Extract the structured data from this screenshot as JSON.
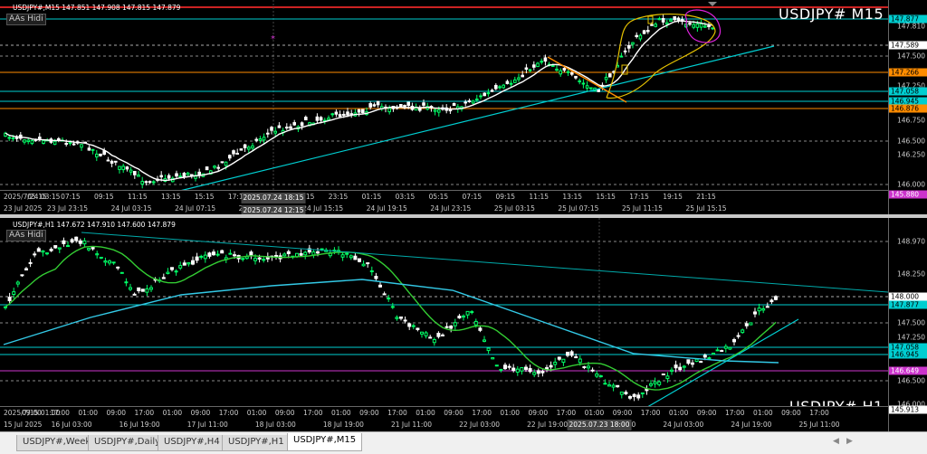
{
  "charts": [
    {
      "title": "USDJPY#,M15  147.851 147.908 147.815 147.879",
      "big_label": "USDJPY#  M15",
      "as_hidi": "AAs Hidi",
      "prices": [
        "147.810",
        "147.500",
        "147.250",
        "146.750",
        "146.500",
        "146.250",
        "146.000"
      ],
      "tags": [
        {
          "label": "147.877",
          "color": "#00ced1"
        },
        {
          "label": "147.589",
          "color": "#ffffff"
        },
        {
          "label": "147.266",
          "color": "#ff8c00"
        },
        {
          "label": "147.058",
          "color": "#00ced1"
        },
        {
          "label": "146.945",
          "color": "#00ced1"
        },
        {
          "label": "146.876",
          "color": "#ff8c00"
        },
        {
          "label": "145.880",
          "color": "#cc33cc"
        }
      ],
      "time_labels": [
        "2025/7/24 03:15",
        "05:15",
        "07:15",
        "09:15",
        "11:15",
        "13:15",
        "15:15",
        "17:15",
        "19:15",
        "21:15",
        "23:15",
        "01:15",
        "03:15",
        "05:15",
        "07:15",
        "09:15",
        "11:15",
        "13:15",
        "15:15",
        "17:15",
        "19:15",
        "21:15"
      ],
      "date_labels": [
        "23 Jul 2025",
        "23 Jul 23:15",
        "24 Jul 03:15",
        "24 Jul 07:15",
        "24 Jul 11:15",
        "24 Jul 15:15",
        "24 Jul 19:15",
        "24 Jul 23:15",
        "25 Jul 03:15",
        "25 Jul 07:15",
        "25 Jul 11:15",
        "25 Jul 15:15"
      ],
      "highlights": [
        "2025.07.24 18:15",
        "2025.07.24 12:15"
      ]
    },
    {
      "title": "USDJPY#,H1  147.672 147.910 147.600 147.879",
      "big_label": "USDJPY#  H1",
      "as_hidi": "AAs Hidi",
      "prices": [
        "148.970",
        "148.250",
        "147.500",
        "147.250",
        "146.500",
        "146.000"
      ],
      "tags": [
        {
          "label": "148.000",
          "color": "#ffffff"
        },
        {
          "label": "147.877",
          "color": "#00ced1"
        },
        {
          "label": "147.058",
          "color": "#00ced1"
        },
        {
          "label": "146.945",
          "color": "#00ced1"
        },
        {
          "label": "146.649",
          "color": "#cc33cc"
        },
        {
          "label": "145.913",
          "color": "#ffffff"
        }
      ],
      "time_labels": [
        "2025/7/15 01:00",
        "09:00",
        "17:00",
        "01:00",
        "09:00",
        "17:00",
        "01:00",
        "09:00",
        "17:00",
        "01:00",
        "09:00",
        "17:00",
        "01:00",
        "09:00",
        "17:00",
        "01:00",
        "09:00",
        "17:00",
        "01:00",
        "09:00",
        "17:00",
        "01:00",
        "09:00",
        "17:00",
        "01:00",
        "09:00",
        "17:00",
        "01:00",
        "09:00",
        "17:00"
      ],
      "date_labels": [
        "15 Jul 2025",
        "16 Jul 03:00",
        "16 Jul 19:00",
        "17 Jul 11:00",
        "18 Jul 03:00",
        "18 Jul 19:00",
        "21 Jul 11:00",
        "22 Jul 03:00",
        "22 Jul 19:00",
        "23 Jul 11:00",
        "24 Jul 03:00",
        "24 Jul 19:00",
        "25 Jul 11:00"
      ],
      "highlights": [
        "2025.07.23 18:00"
      ]
    }
  ],
  "tabs": [
    "USDJPY#,Weekly",
    "USDJPY#,Daily",
    "USDJPY#,H4",
    "USDJPY#,H1",
    "USDJPY#,M15"
  ],
  "active_tab": "USDJPY#,M15"
}
